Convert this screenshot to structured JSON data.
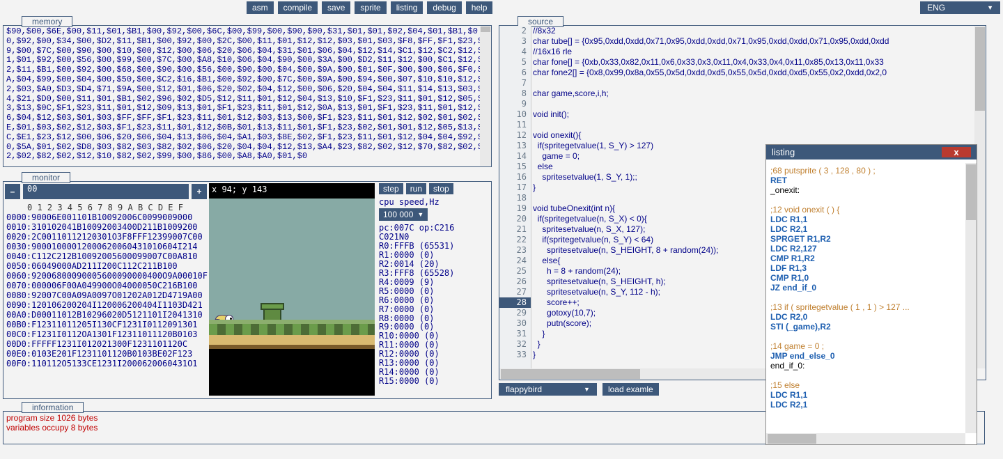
{
  "top": {
    "asm": "asm",
    "compile": "compile",
    "save": "save",
    "sprite": "sprite",
    "listing": "listing",
    "debug": "debug",
    "help": "help",
    "lang": "ENG",
    "tri": "▼"
  },
  "panels": {
    "memory": "memory",
    "monitor": "monitor",
    "source": "source",
    "information": "information"
  },
  "memory_text": "$90,$00,$6E,$00,$11,$01,$B1,$00,$92,$00,$6C,$00,$99,$00,$90,$00,$31,$01,$01,$02,$04,$01,$B1,$00,$92,$00,$34,$00,$D2,$11,$B1,$00,$92,$00,$2C,$00,$11,$01,$12,$12,$03,$01,$03,$F8,$FF,$F1,$23,$99,$00,$7C,$00,$90,$00,$10,$00,$12,$00,$06,$20,$06,$04,$31,$01,$06,$04,$12,$14,$C1,$12,$C2,$12,$B1,$01,$92,$00,$56,$00,$99,$00,$7C,$00,$A8,$10,$06,$04,$90,$00,$3A,$00,$D2,$11,$12,$00,$C1,$12,$C2,$11,$B1,$00,$92,$00,$68,$00,$90,$00,$56,$00,$90,$00,$04,$00,$9A,$00,$01,$0F,$00,$00,$06,$F0,$0A,$04,$99,$00,$04,$00,$50,$00,$C2,$16,$B1,$00,$92,$00,$7C,$00,$9A,$00,$94,$00,$07,$10,$10,$12,$12,$03,$A0,$D3,$D4,$71,$9A,$00,$12,$01,$06,$20,$02,$04,$12,$00,$06,$20,$04,$04,$11,$14,$13,$03,$04,$21,$D0,$00,$11,$01,$B1,$02,$96,$02,$D5,$12,$11,$01,$12,$04,$13,$10,$F1,$23,$11,$01,$12,$05,$13,$13,$0C,$F1,$23,$11,$01,$12,$09,$13,$01,$F1,$23,$11,$01,$12,$0A,$13,$01,$F1,$23,$11,$01,$12,$06,$04,$12,$03,$01,$03,$FF,$FF,$F1,$23,$11,$01,$12,$03,$13,$00,$F1,$23,$11,$01,$12,$02,$01,$02,$0E,$01,$03,$02,$12,$03,$F1,$23,$11,$01,$12,$0B,$01,$13,$11,$01,$F1,$23,$02,$01,$01,$12,$05,$13,$3C,$E1,$23,$12,$00,$06,$20,$06,$04,$13,$06,$04,$A1,$03,$8E,$02,$F1,$23,$11,$01,$12,$04,$04,$92,$00,$5A,$01,$02,$D8,$03,$82,$03,$82,$02,$06,$20,$04,$04,$12,$13,$A4,$23,$82,$02,$12,$70,$82,$02,$12,$02,$82,$02,$12,$10,$82,$02,$99,$00,$86,$00,$A8,$A0,$01,$0",
  "monitor": {
    "value": "00",
    "plus": "+",
    "minus": "–",
    "hex_header": "0 1 2 3 4 5 6 7 8 9 A B C D E F",
    "rows": [
      "0000:90006E001101B10092006C0099009000",
      "0010:310102041B10092003400D211B1009200",
      "0020:2C00110112120301O3F8FFF12399007C00",
      "0030:90001000012000620060431010604I214",
      "0040:C112C212B10092005600099007C00A810",
      "0050:06049000AD211I200C112C211B100",
      "0060:92006800090005600090000400O9A00010F",
      "0070:000006F00A049900O04000050C216B100",
      "0080:92007C00A09A0097O01202A012D4719A00",
      "0090:120106200204I120006200404I1103D421",
      "00A0:D00011012B10296020D5121101I2041310",
      "00B0:F12311011205I130CF1231I0112091301",
      "00C0:F1231I0112OA1301F12311011120B0103",
      "00D0:FFFFF1231I012021300F1231101120C",
      "00E0:0103E201F1231101120B0103BE02F123",
      "00F0:110112O5133CE1231I2000620060431O1"
    ],
    "coords": "x 94; y 143",
    "step": "step",
    "run": "run",
    "stop": "stop",
    "cpu_label": "cpu speed,Hz",
    "speed": "100 000",
    "pc": "pc:007C op:C216",
    "c": "C021N0",
    "regs": [
      "R0:FFFB (65531)",
      "R1:0000 (0)",
      "R2:0014 (20)",
      "R3:FFF8 (65528)",
      "R4:0009 (9)",
      "R5:0000 (0)",
      "R6:0000 (0)",
      "R7:0000 (0)",
      "R8:0000 (0)",
      "R9:0000 (0)",
      "R10:0000 (0)",
      "R11:0000 (0)",
      "R12:0000 (0)",
      "R13:0000 (0)",
      "R14:0000 (0)",
      "R15:0000 (0)"
    ]
  },
  "source": {
    "first_line": 2,
    "highlight_line": 28,
    "lines": [
      "//8x32",
      "char tube[] = {0x95,0xdd,0xdd,0x71,0x95,0xdd,0xdd,0x71,0x95,0xdd,0xdd,0x71,0x95,0xdd,0xdd",
      "//16x16 rle",
      "char fone[] = {0xb,0x33,0x82,0x11,0x6,0x33,0x3,0x11,0x4,0x33,0x4,0x11,0x85,0x13,0x11,0x33",
      "char fone2[] = {0x8,0x99,0x8a,0x55,0x5d,0xdd,0xd5,0x55,0x5d,0xdd,0xd5,0x55,0x2,0xdd,0x2,0",
      "",
      "char game,score,i,h;",
      "",
      "void init();",
      "",
      "void onexit(){",
      "  if(spritegetvalue(1, S_Y) > 127)",
      "    game = 0;",
      "  else",
      "    spritesetvalue(1, S_Y, 1);;",
      "}",
      "",
      "void tubeOnexit(int n){",
      "  if(spritegetvalue(n, S_X) < 0){",
      "    spritesetvalue(n, S_X, 127);",
      "    if(spritegetvalue(n, S_Y) < 64)",
      "      spritesetvalue(n, S_HEIGHT, 8 + random(24));",
      "    else{",
      "      h = 8 + random(24);",
      "      spritesetvalue(n, S_HEIGHT, h);",
      "      spritesetvalue(n, S_Y, 112 - h);",
      "      score++;",
      "      gotoxy(10,7);",
      "      putn(score);",
      "    }",
      "  }",
      "}"
    ]
  },
  "source_bottom": {
    "example": "flappybird",
    "tri": "▼",
    "load": "load examle"
  },
  "information": {
    "l1": "program size 1026 bytes",
    "l2": "variables occupy 8 bytes"
  },
  "listing_win": {
    "title": "listing",
    "close": "x",
    "lines": [
      {
        "c": "cmt",
        "t": ";68 putsprite ( 3 , 128 , 80 ) ;"
      },
      {
        "c": "kw",
        "t": "RET"
      },
      {
        "c": "lbl",
        "t": "_onexit:"
      },
      {
        "c": "",
        "t": ""
      },
      {
        "c": "cmt",
        "t": ";12 void onexit ( ) {"
      },
      {
        "c": "kw",
        "t": "LDC R1,1"
      },
      {
        "c": "kw",
        "t": "LDC R2,1"
      },
      {
        "c": "kw",
        "t": "SPRGET R1,R2"
      },
      {
        "c": "kw",
        "t": "LDC R2,127"
      },
      {
        "c": "kw",
        "t": "CMP R1,R2"
      },
      {
        "c": "kw",
        "t": "LDF R1,3"
      },
      {
        "c": "kw",
        "t": "CMP R1,0"
      },
      {
        "c": "kw",
        "t": "JZ end_if_0"
      },
      {
        "c": "",
        "t": ""
      },
      {
        "c": "cmt",
        "t": ";13 if ( spritegetvalue ( 1 , 1 ) > 127 ..."
      },
      {
        "c": "kw",
        "t": "LDC R2,0"
      },
      {
        "c": "kw",
        "t": "STI (_game),R2"
      },
      {
        "c": "",
        "t": ""
      },
      {
        "c": "cmt",
        "t": ";14 game = 0 ;"
      },
      {
        "c": "kw",
        "t": "JMP end_else_0"
      },
      {
        "c": "lbl",
        "t": "end_if_0:"
      },
      {
        "c": "",
        "t": ""
      },
      {
        "c": "cmt",
        "t": ";15 else"
      },
      {
        "c": "kw",
        "t": "LDC R1,1"
      },
      {
        "c": "kw",
        "t": "LDC R2,1"
      }
    ]
  }
}
